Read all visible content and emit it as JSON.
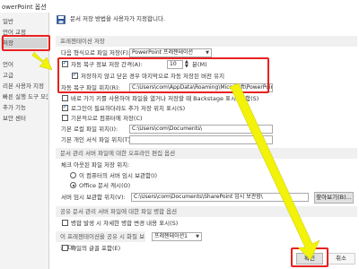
{
  "window": {
    "title": "owerPoint 옵션"
  },
  "sidebar": {
    "items": [
      {
        "label": "일반"
      },
      {
        "label": "언어 교정"
      },
      {
        "label": "저장"
      },
      {
        "label": ""
      },
      {
        "label": "언어"
      },
      {
        "label": "고급"
      },
      {
        "label": "리본 사용자 지정"
      },
      {
        "label": "빠른 실행 도구 모음"
      },
      {
        "label": "추가 기능"
      },
      {
        "label": "보안 센터"
      }
    ],
    "active_index": 2
  },
  "main": {
    "header_text": "문서 저장 방법을 사용자가 지정합니다.",
    "section_save": "프레젠테이션 저장",
    "format_label": "다음 형식으로 파일 저장(F):",
    "format_value": "PowerPoint 프레젠테이션",
    "autorecover_label": "자동 복구 정보 저장 간격(A):",
    "autorecover_minutes": "10",
    "minutes_unit": "분(M)",
    "keep_last_label": "저장하지 않고 닫은 경우 마지막으로 자동 저장된 버전 유지",
    "autorecover_path_label": "자동 복구 파일 위치(R):",
    "autorecover_path": "C:\\Users\\com\\AppData\\Roaming\\Microsoft\\PowerPoint\\",
    "backstage_label": "바로 가기 키를 사용하여 파일을 열거나 저장할 때 Backstage 표시 안 함(S)",
    "show_more_places_label": "로그인이 필요하더라도 추가 저장 위치 표시(S)",
    "default_computer_label": "기본적으로 컴퓨터에 저장(C)",
    "default_local_label": "기본 로컬 파일 위치(I):",
    "default_local_path": "C:\\Users\\com\\Documents\\",
    "default_personal_label": "기본 개인 서식 파일 위치(T):",
    "default_personal_path": "",
    "section_offline": "문서 관리 서버 파일에 대한 오프라인 편집 옵션",
    "checkout_label": "체크 아웃된 파일 저장 위치:",
    "server_drafts_label": "이 컴퓨터의 서버 임시 보관함(I)",
    "office_cache_label": "Office 문서 캐시(O)",
    "server_drafts_location_label": "서버 임시 보관함 위치(V):",
    "server_drafts_path": "C:\\Users\\com\\Documents\\SharePoint 임시 보관함\\",
    "browse_button": "찾아보기(B)...",
    "section_shared": "공유 문서 관리 서버 파일에 대한 파일 병합 옵션",
    "merge_label": "병합 발생 시 자세한 병합 변경 내용 표시(S)",
    "section_fidelity": "이 프레젠테이션을 공유 시 화질 보존(D):",
    "fidelity_value": "프레젠테이션1",
    "embed_fonts_label": "파일의 글꼴 포함(E)",
    "ok_button": "확인",
    "cancel_button": "취소"
  }
}
